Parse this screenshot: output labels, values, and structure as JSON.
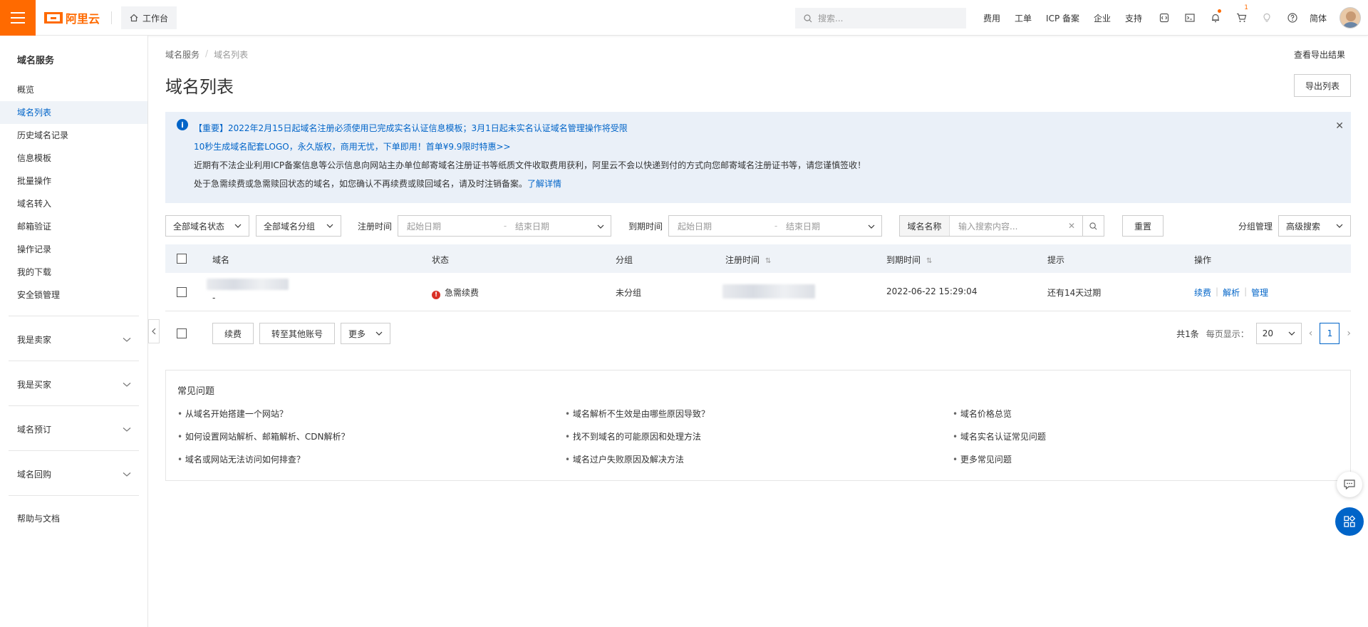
{
  "topbar": {
    "logo_text": "阿里云",
    "workbench_label": "工作台",
    "search_placeholder": "搜索...",
    "links": [
      "费用",
      "工单",
      "ICP 备案",
      "企业",
      "支持"
    ],
    "cart_badge": "1",
    "language": "简体"
  },
  "sidebar": {
    "title": "域名服务",
    "items": [
      "概览",
      "域名列表",
      "历史域名记录",
      "信息模板",
      "批量操作",
      "域名转入",
      "邮箱验证",
      "操作记录",
      "我的下载",
      "安全锁管理"
    ],
    "active_index": 1,
    "groups": [
      "我是卖家",
      "我是买家",
      "域名预订",
      "域名回购"
    ],
    "help": "帮助与文档"
  },
  "breadcrumb": [
    "域名服务",
    "/",
    "域名列表"
  ],
  "view_export_results": "查看导出结果",
  "page_title": "域名列表",
  "export_list_button": "导出列表",
  "notice": {
    "line1": "【重要】2022年2月15日起域名注册必须使用已完成实名认证信息模板；3月1日起未实名认证域名管理操作将受限",
    "line2": "10秒生成域名配套LOGO，永久版权，商用无忧，下单即用！首单¥9.9限时特惠>>",
    "line3": "近期有不法企业利用ICP备案信息等公示信息向网站主办单位邮寄域名注册证书等纸质文件收取费用获利，阿里云不会以快递到付的方式向您邮寄域名注册证书等，请您谨慎签收！",
    "line4_text": "处于急需续费或急需赎回状态的域名，如您确认不再续费或赎回域名，请及时注销备案。",
    "line4_link": "了解详情"
  },
  "filters": {
    "status_select": "全部域名状态",
    "group_select": "全部域名分组",
    "reg_time_label": "注册时间",
    "expire_time_label": "到期时间",
    "start_date_placeholder": "起始日期",
    "end_date_placeholder": "结束日期",
    "search_field_label": "域名名称",
    "search_placeholder": "输入搜索内容...",
    "reset_button": "重置",
    "group_manage": "分组管理",
    "advanced_search": "高级搜索"
  },
  "table": {
    "columns": [
      "域名",
      "状态",
      "分组",
      "注册时间",
      "到期时间",
      "提示",
      "操作"
    ],
    "rows": [
      {
        "domain_sub": "-",
        "status": "急需续费",
        "group": "未分组",
        "expire_time": "2022-06-22 15:29:04",
        "hint": "还有14天过期",
        "actions": [
          "续费",
          "解析",
          "管理"
        ]
      }
    ]
  },
  "batch": {
    "renew": "续费",
    "transfer": "转至其他账号",
    "more": "更多"
  },
  "pagination": {
    "total": "共1条",
    "per_page_label": "每页显示：",
    "per_page": "20",
    "current_page": "1"
  },
  "faq": {
    "title": "常见问题",
    "col1": [
      "从域名开始搭建一个网站？",
      "如何设置网站解析、邮箱解析、CDN解析？",
      "域名或网站无法访问如何排查？"
    ],
    "col2": [
      "域名解析不生效是由哪些原因导致？",
      "找不到域名的可能原因和处理方法",
      "域名过户失败原因及解决方法"
    ],
    "col3": [
      "域名价格总览",
      "域名实名认证常见问题",
      "更多常见问题"
    ]
  },
  "colors": {
    "brand_orange": "#ff6a00",
    "link_blue": "#0064c8",
    "warning_red": "#d93026"
  }
}
